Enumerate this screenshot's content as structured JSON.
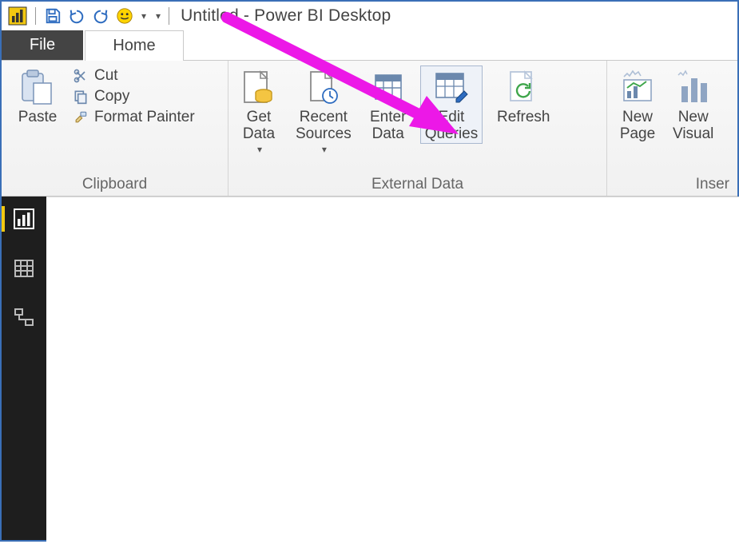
{
  "window": {
    "title": "Untitled - Power BI Desktop"
  },
  "tabs": {
    "file": "File",
    "home": "Home"
  },
  "ribbon": {
    "clipboard": {
      "label": "Clipboard",
      "paste": "Paste",
      "cut": "Cut",
      "copy": "Copy",
      "format_painter": "Format Painter"
    },
    "external_data": {
      "label": "External Data",
      "get_data": "Get\nData",
      "recent_sources": "Recent\nSources",
      "enter_data": "Enter\nData",
      "edit_queries": "Edit\nQueries",
      "refresh": "Refresh"
    },
    "insert": {
      "label": "Inser",
      "new_page": "New\nPage",
      "new_visual": "New\nVisual"
    }
  }
}
